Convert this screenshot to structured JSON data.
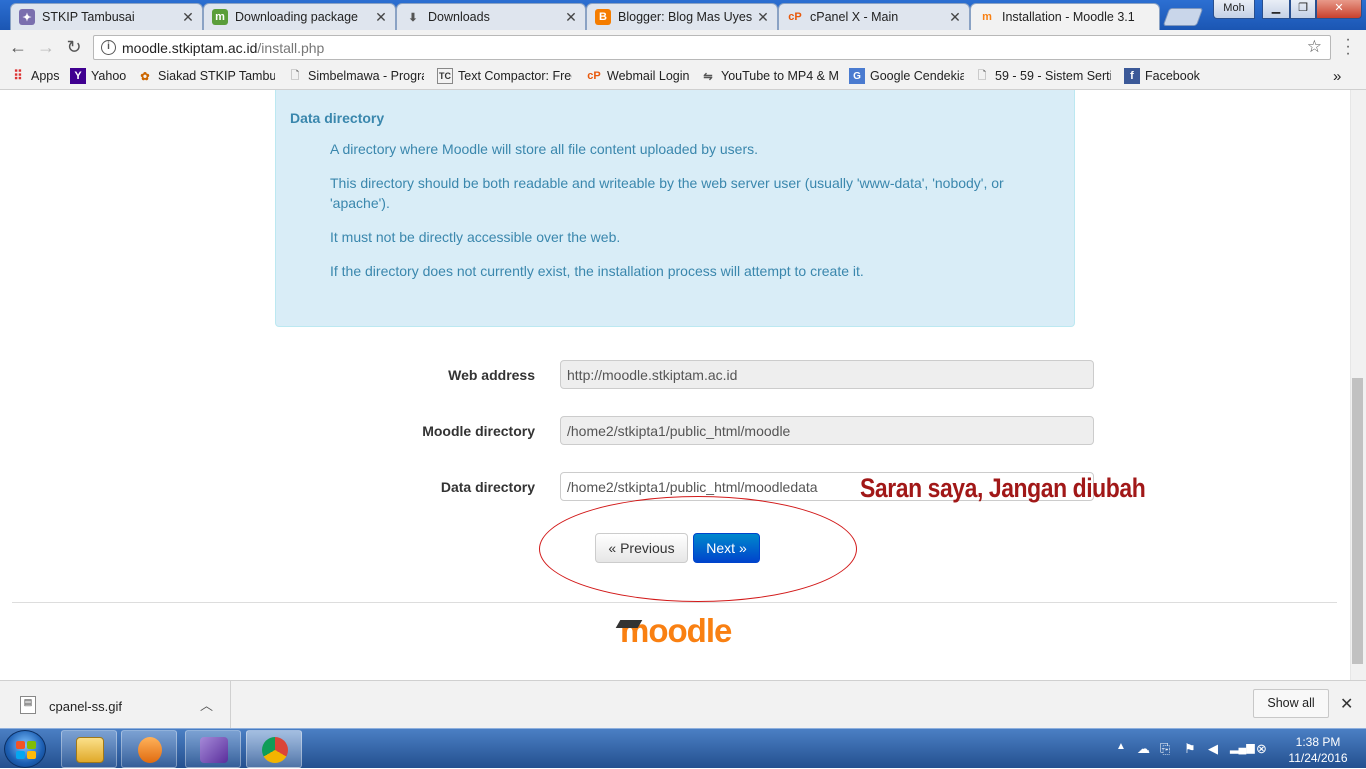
{
  "browser": {
    "tabs": [
      {
        "title": "STKIP Tambusai",
        "icon": "stkip-logo-icon",
        "active": false
      },
      {
        "title": "Downloading package",
        "icon": "moodle-green-icon",
        "active": false
      },
      {
        "title": "Downloads",
        "icon": "download-icon",
        "active": false
      },
      {
        "title": "Blogger: Blog Mas Uyes",
        "icon": "blogger-icon",
        "active": false
      },
      {
        "title": "cPanel X - Main",
        "icon": "cpanel-icon",
        "active": false
      },
      {
        "title": "Installation - Moodle 3.1",
        "icon": "moodle-icon",
        "active": true
      }
    ],
    "window_user": "Moh",
    "url_host": "moodle.stkiptam.ac.id",
    "url_path": "/install.php",
    "bookmarks": [
      {
        "label": "Apps",
        "icon": "apps-grid-icon"
      },
      {
        "label": "Yahoo",
        "icon": "yahoo-icon"
      },
      {
        "label": "Siakad STKIP Tambusa",
        "icon": "siakad-icon"
      },
      {
        "label": "Simbelmawa - Progra",
        "icon": "page-icon"
      },
      {
        "label": "Text Compactor: Free",
        "icon": "text-compactor-icon"
      },
      {
        "label": "Webmail Login",
        "icon": "cpanel-icon"
      },
      {
        "label": "YouTube to MP4 & M",
        "icon": "youtube-converter-icon"
      },
      {
        "label": "Google Cendekia",
        "icon": "google-scholar-icon"
      },
      {
        "label": "59 - 59 - Sistem Sertif",
        "icon": "page-icon"
      },
      {
        "label": "Facebook",
        "icon": "facebook-icon"
      }
    ],
    "more_bookmarks": "»"
  },
  "page": {
    "info_title": "Data directory",
    "info_paragraphs": [
      "A directory where Moodle will store all file content uploaded by users.",
      "This directory should be both readable and writeable by the web server user (usually 'www-data', 'nobody', or 'apache').",
      "It must not be directly accessible over the web.",
      "If the directory does not currently exist, the installation process will attempt to create it."
    ],
    "fields": {
      "web_address": {
        "label": "Web address",
        "value": "http://moodle.stkiptam.ac.id"
      },
      "moodle_directory": {
        "label": "Moodle directory",
        "value": "/home2/stkipta1/public_html/moodle"
      },
      "data_directory": {
        "label": "Data directory",
        "value": "/home2/stkipta1/public_html/moodledata"
      }
    },
    "buttons": {
      "previous": "« Previous",
      "next": "Next »"
    },
    "annotation": "Saran saya, Jangan diubah",
    "logo_text": "moodle"
  },
  "download_bar": {
    "file_name": "cpanel-ss.gif",
    "show_all": "Show all"
  },
  "taskbar": {
    "time": "1:38 PM",
    "date": "11/24/2016",
    "pinned": [
      "explorer-icon",
      "media-player-icon",
      "visual-studio-icon",
      "chrome-icon"
    ]
  },
  "colors": {
    "accent": "#0070d0",
    "info_text": "#3a87ad",
    "info_bg": "#d9edf7",
    "annotation": "#a11818",
    "moodle_orange": "#f98012"
  }
}
